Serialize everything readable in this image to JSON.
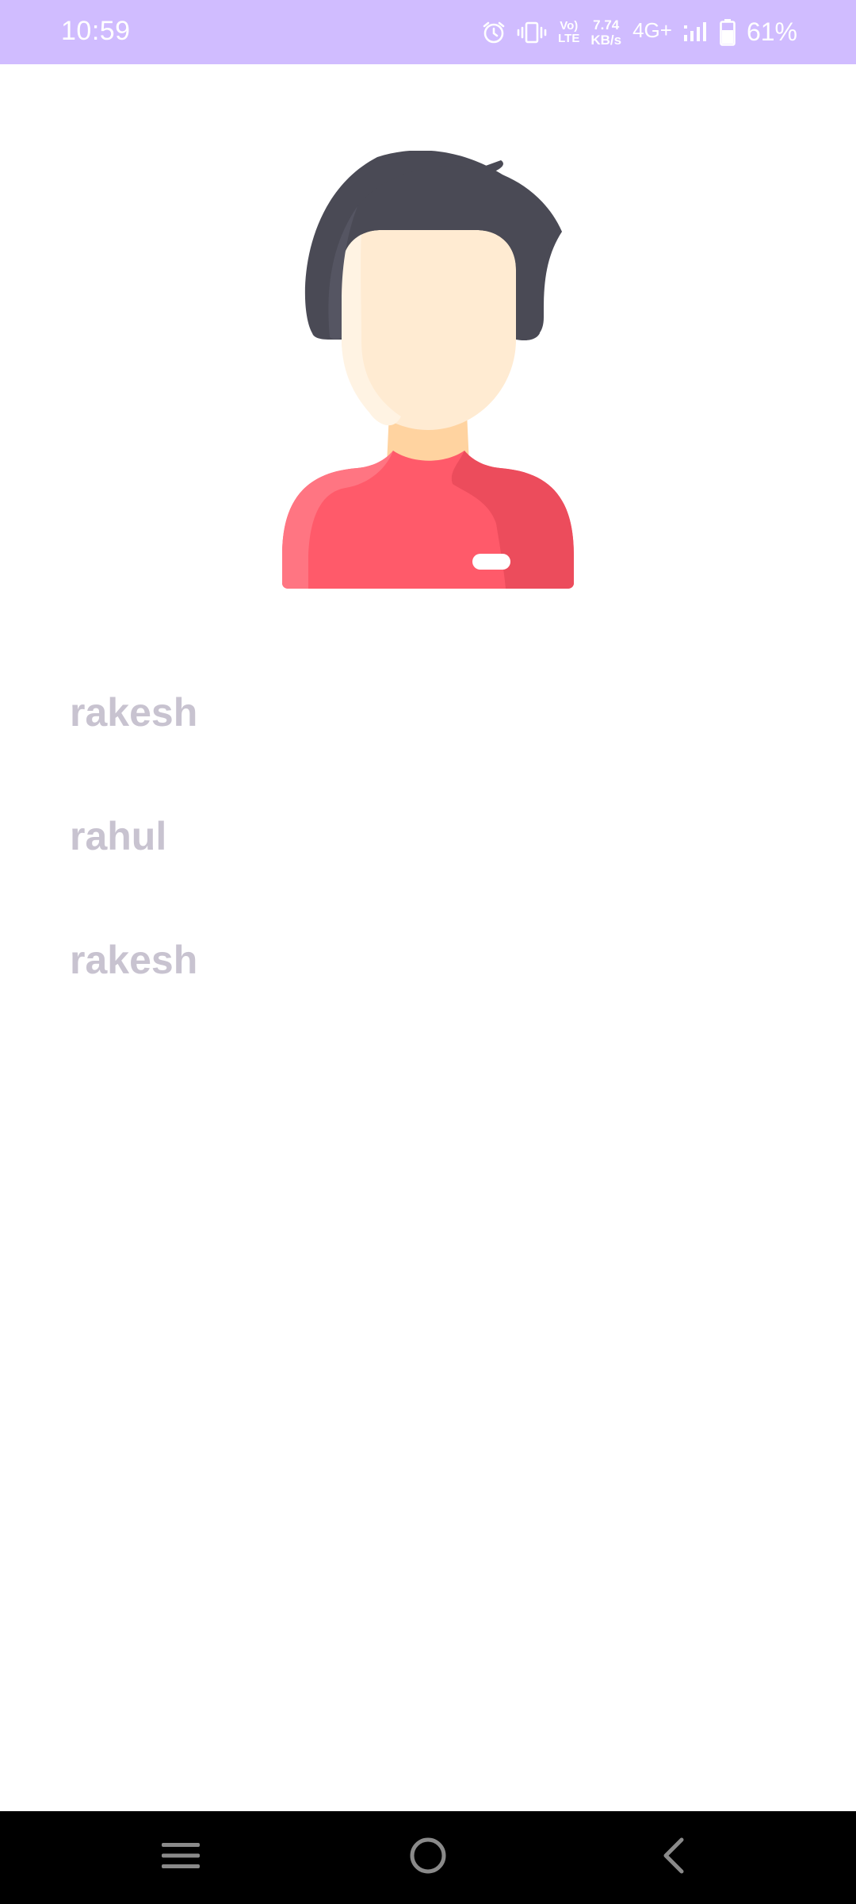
{
  "status_bar": {
    "time": "10:59",
    "volte_top": "Vo)",
    "volte_bottom": "LTE",
    "speed_value": "7.74",
    "speed_unit": "KB/s",
    "network_type": "4G+",
    "battery_percent": "61%",
    "icons": [
      "alarm-icon",
      "vibrate-icon",
      "volte-icon",
      "signal-icon",
      "battery-icon"
    ],
    "background_color": "#D0BCFF"
  },
  "profile": {
    "avatar_icon": "male-user-avatar-icon"
  },
  "names": [
    {
      "label": "rakesh"
    },
    {
      "label": "rahul"
    },
    {
      "label": "rakesh"
    }
  ],
  "nav_bar": {
    "icons": [
      "recents-menu-icon",
      "home-circle-icon",
      "back-chevron-icon"
    ]
  },
  "colors": {
    "name_text": "#C8C3D0",
    "shirt": "#FF5A6A",
    "hair": "#4A4A55",
    "skin": "#FFEBD2"
  }
}
